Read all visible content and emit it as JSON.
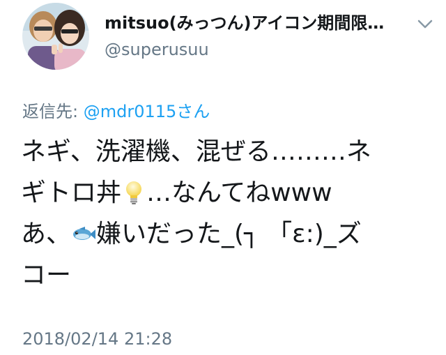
{
  "author": {
    "display_name": "mitsuo(みっつん)アイコン期間限…",
    "username": "@superusuu"
  },
  "reply": {
    "prefix": "返信先: ",
    "handle": "@mdr0115",
    "suffix": "さん"
  },
  "tweet": {
    "line1": "ネギ、洗濯機、混ぜる………ネ",
    "line2_a": "ギトロ丼",
    "line2_emoji": "light-bulb-icon",
    "line2_b": "…なんてねwww",
    "line3_a": "あ、",
    "line3_emoji": "fish-icon",
    "line3_b": "嫌いだった_(┐ 「ε:)_ズ",
    "line4": "コー"
  },
  "timestamp": "2018/02/14 21:28",
  "colors": {
    "text": "#14171a",
    "secondary": "#657786",
    "link": "#1da1f2"
  }
}
